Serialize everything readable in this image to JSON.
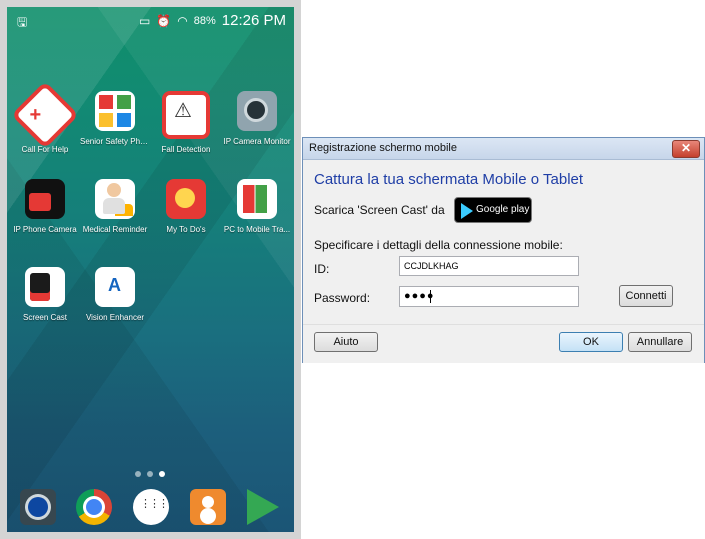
{
  "phone": {
    "status": {
      "left_icon": "🖫",
      "cast_icon": "▭",
      "alarm_icon": "⏰",
      "wifi_icon": "◠",
      "battery": "88%",
      "time": "12:26 PM"
    },
    "apps": [
      {
        "label": "Call For Help"
      },
      {
        "label": "Senior Safety Pho..."
      },
      {
        "label": "Fall Detection"
      },
      {
        "label": "IP Camera Monitor"
      },
      {
        "label": "IP Phone Camera"
      },
      {
        "label": "Medical Reminder"
      },
      {
        "label": "My To Do's"
      },
      {
        "label": "PC to Mobile Tra..."
      },
      {
        "label": "Screen Cast"
      },
      {
        "label": "Vision Enhancer"
      }
    ],
    "dock": [
      "camera-icon",
      "chrome-icon",
      "app-drawer-icon",
      "contacts-icon",
      "play-store-icon"
    ]
  },
  "dialog": {
    "title": "Registrazione schermo mobile",
    "close_glyph": "✕",
    "heading": "Cattura la tua schermata Mobile o Tablet",
    "download_label": "Scarica 'Screen Cast' da",
    "google_play_text": "Google play",
    "connection_label": "Specificare i dettagli della connessione mobile:",
    "id_label": "ID:",
    "id_value": "CCJDLKHAG",
    "password_label": "Password:",
    "password_mask": "●●●●",
    "connect_label": "Connetti",
    "help_label": "Aiuto",
    "ok_label": "OK",
    "cancel_label": "Annullare"
  }
}
